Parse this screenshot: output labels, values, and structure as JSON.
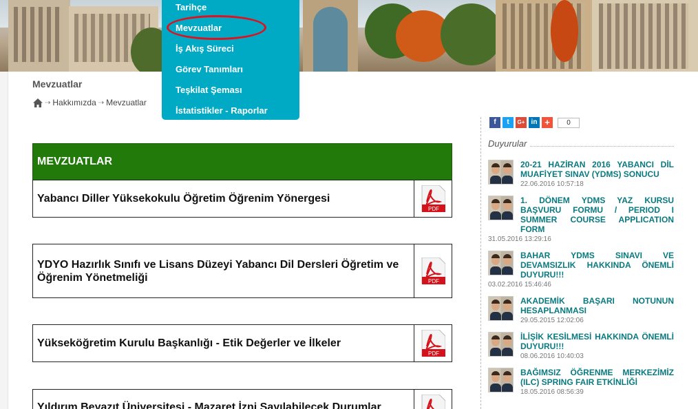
{
  "menu": {
    "items": [
      "Tarihçe",
      "Mevzuatlar",
      "İş Akış Süreci",
      "Görev Tanımları",
      "Teşkilat Şeması",
      "İstatistikler - Raporlar"
    ]
  },
  "page": {
    "title": "Mevzuatlar",
    "breadcrumb": [
      "Hakkımızda",
      "Mevzuatlar"
    ]
  },
  "section": {
    "heading": "MEVZUATLAR",
    "documents": [
      "Yabancı Diller Yüksekokulu Öğretim Öğrenim Yönergesi",
      "YDYO Hazırlık Sınıfı ve Lisans Düzeyi Yabancı Dil Dersleri Öğretim ve Öğrenim Yönetmeliği",
      "Yükseköğretim Kurulu Başkanlığı - Etik Değerler ve İlkeler",
      "Yıldırım Beyazıt Üniversitesi - Mazaret İzni Sayılabilecek Durumlar"
    ],
    "pdf_label": "PDF"
  },
  "share": {
    "buttons": [
      "f",
      "t",
      "G+",
      "in",
      "+"
    ],
    "count": "0"
  },
  "sidebar": {
    "heading": "Duyurular",
    "announcements": [
      {
        "title": "20-21 HAZİRAN 2016 YABANCI DİL MUAFİYET SINAV (YDMS) SONUCU",
        "date": "22.06.2016 10:57:18"
      },
      {
        "title": "1. DÖNEM YDMS YAZ KURSU BAŞVURU FORMU / PERIOD I SUMMER COURSE APPLICATION FORM",
        "date": "31.05.2016 13:29:16"
      },
      {
        "title": "BAHAR YDMS SINAVI VE DEVAMSIZLIK HAKKINDA ÖNEMLİ DUYURU!!!",
        "date": "03.02.2016 15:46:46"
      },
      {
        "title": "AKADEMİK BAŞARI NOTUNUN HESAPLANMASI",
        "date": "29.05.2015 12:02:06"
      },
      {
        "title": "İLİŞİK KESİLMESİ HAKKINDA ÖNEMLİ DUYURU!!!",
        "date": "08.06.2016 10:40:03"
      },
      {
        "title": "BAĞIMSIZ ÖĞRENME MERKEZİMİZ (ILC) SPRING FAIR ETKİNLİĞİ",
        "date": "18.05.2016 08:56:39"
      }
    ]
  },
  "colors": {
    "menu_bg": "#00aac5",
    "section_green": "#227a0b",
    "announcement_teal": "#087a80",
    "highlight_red": "#e0101e"
  }
}
